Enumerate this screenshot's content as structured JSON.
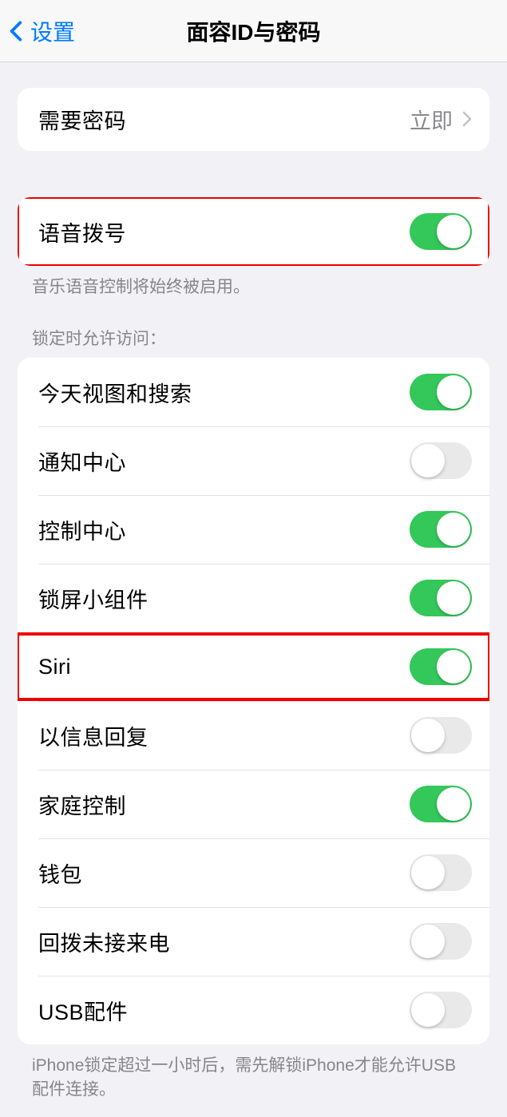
{
  "nav": {
    "back": "设置",
    "title": "面容ID与密码"
  },
  "passcodeSection": {
    "require": {
      "label": "需要密码",
      "value": "立即"
    }
  },
  "voiceDialSection": {
    "item": {
      "label": "语音拨号",
      "on": true
    },
    "footer": "音乐语音控制将始终被启用。"
  },
  "lockedSection": {
    "header": "锁定时允许访问：",
    "items": [
      {
        "label": "今天视图和搜索",
        "on": true
      },
      {
        "label": "通知中心",
        "on": false
      },
      {
        "label": "控制中心",
        "on": true
      },
      {
        "label": "锁屏小组件",
        "on": true
      },
      {
        "label": "Siri",
        "on": true,
        "highlight": true
      },
      {
        "label": "以信息回复",
        "on": false
      },
      {
        "label": "家庭控制",
        "on": true
      },
      {
        "label": "钱包",
        "on": false
      },
      {
        "label": "回拨未接来电",
        "on": false
      },
      {
        "label": "USB配件",
        "on": false
      }
    ],
    "footer": "iPhone锁定超过一小时后，需先解锁iPhone才能允许USB 配件连接。"
  }
}
